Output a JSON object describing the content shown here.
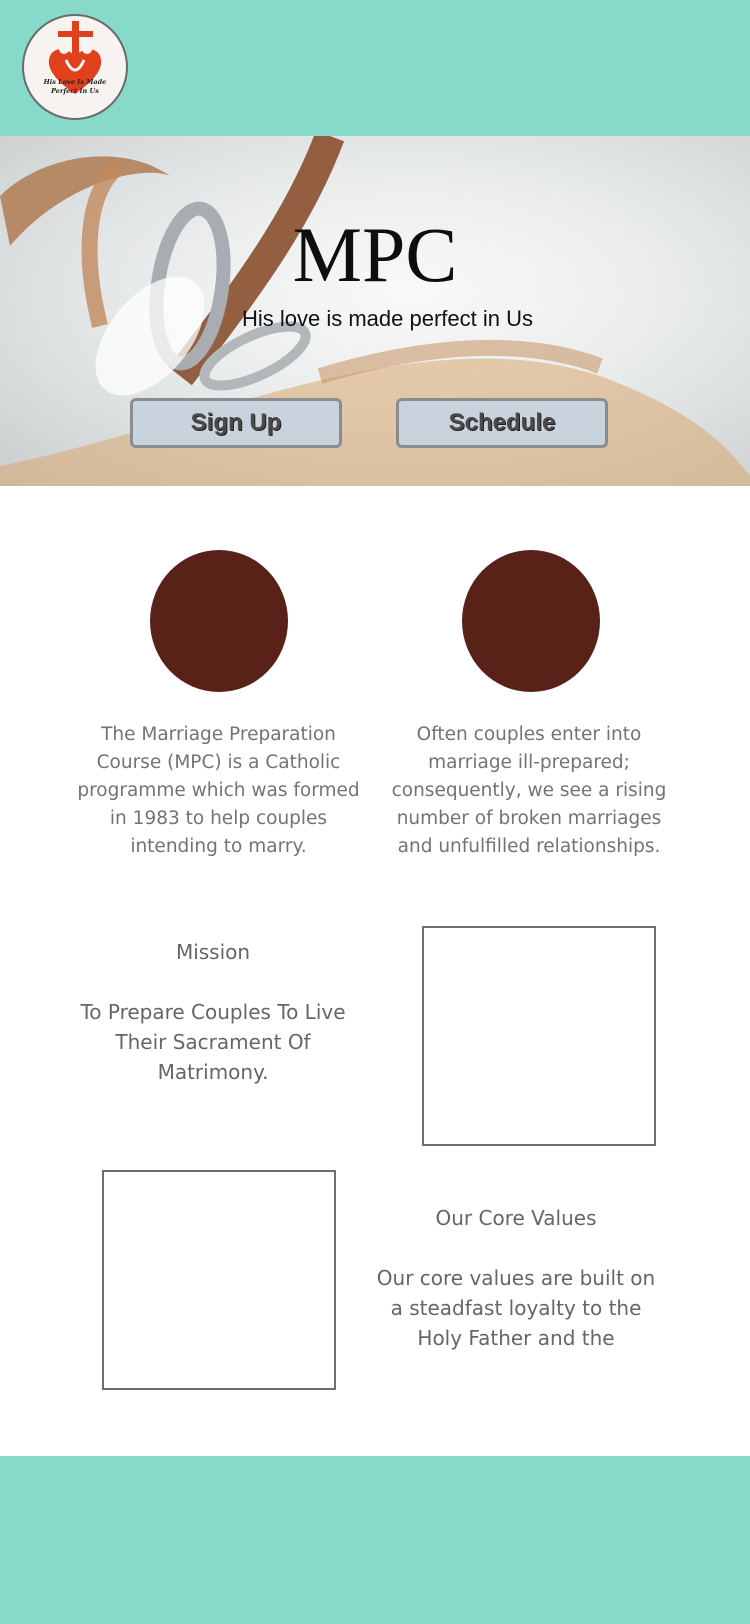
{
  "logo": {
    "icon": "cross-heart-logo-icon",
    "tagline_line1": "His Love Is Made",
    "tagline_line2": "Perfect In Us",
    "colors": {
      "mark": "#e0401c"
    }
  },
  "hero": {
    "title": "MPC",
    "subtitle": "His love is made perfect in Us",
    "buttons": {
      "signup": "Sign Up",
      "schedule": "Schedule"
    }
  },
  "intro": {
    "left_text": "The Marriage Preparation Course (MPC) is a Catholic programme which was formed in 1983 to help couples intending to marry.",
    "right_text": "Often couples enter into marriage ill-prepared; consequently, we see a rising number of broken marriages and unfulfilled relationships."
  },
  "mission": {
    "title": "Mission",
    "body": "To Prepare Couples To Live Their Sacrament Of Matrimony."
  },
  "core_values": {
    "title": "Our Core Values",
    "body": "Our core values are built on a steadfast loyalty to the Holy Father and the"
  },
  "colors": {
    "header_footer": "#87d9c9",
    "circle": "#592218",
    "button_bg": "#c9d3de",
    "text_gray": "#737373"
  }
}
